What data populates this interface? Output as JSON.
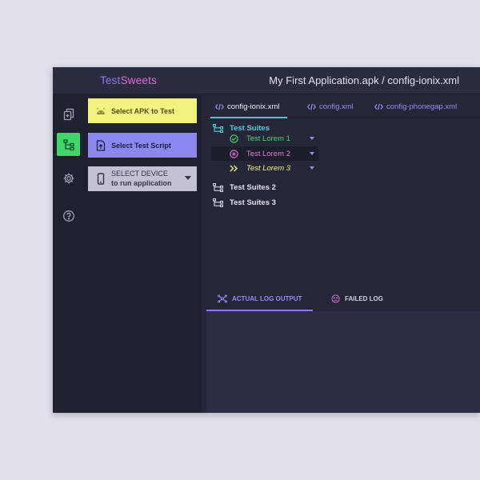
{
  "app": {
    "brand_part1": "Test",
    "brand_part2": "Sweets",
    "window_title": "My First Application.apk / config-ionix.xml"
  },
  "iconbar": {
    "items": [
      {
        "icon": "copy-add-icon",
        "active": false
      },
      {
        "icon": "tree-structure-icon",
        "active": true
      },
      {
        "icon": "gear-icon",
        "active": false
      },
      {
        "icon": "help-circle-icon",
        "active": false
      }
    ]
  },
  "left_panel": {
    "select_apk_label": "Select APK to Test",
    "select_script_label": "Select Test Script",
    "device_line1": "SELECT DEVICE",
    "device_line2": "to run application"
  },
  "tabs": [
    {
      "label": "config-ionix.xml",
      "active": true
    },
    {
      "label": "config.xml",
      "active": false
    },
    {
      "label": "config-phonegap.xml",
      "active": false
    }
  ],
  "tree": {
    "root": "Test Suites",
    "children": [
      {
        "label": "Test Lorem 1",
        "status": "passed"
      },
      {
        "label": "Test Lorem 2",
        "status": "failed"
      },
      {
        "label": "Test Lorem 3",
        "status": "skipped"
      }
    ],
    "suite2": "Test Suites 2",
    "suite3": "Test Suites 3"
  },
  "log_tabs": [
    {
      "label": "ACTUAL LOG OUTPUT",
      "active": true
    },
    {
      "label": "FAILED LOG",
      "active": false
    }
  ],
  "colors": {
    "accent_purple": "#8d7af2",
    "accent_pink": "#e26bd5",
    "success_green": "#3ed669",
    "teal": "#46d5d8",
    "warning_yellow": "#f3f27e"
  }
}
